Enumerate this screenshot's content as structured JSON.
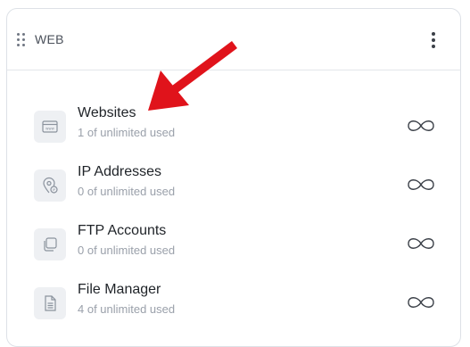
{
  "card": {
    "title": "WEB",
    "drag_icon": "drag-handle-icon",
    "menu_icon": "more-vertical-icon"
  },
  "items": [
    {
      "name": "Websites",
      "usage": "1 of unlimited used",
      "icon": "website-icon",
      "limit_icon": "infinity-icon"
    },
    {
      "name": "IP Addresses",
      "usage": "0 of unlimited used",
      "icon": "ip-address-icon",
      "limit_icon": "infinity-icon"
    },
    {
      "name": "FTP Accounts",
      "usage": "0 of unlimited used",
      "icon": "ftp-accounts-icon",
      "limit_icon": "infinity-icon"
    },
    {
      "name": "File Manager",
      "usage": "4 of unlimited used",
      "icon": "file-manager-icon",
      "limit_icon": "infinity-icon"
    }
  ],
  "annotation": {
    "arrow_color": "#e0131b",
    "arrow_icon": "pointer-arrow-icon"
  },
  "colors": {
    "icon_bg": "#eef0f3",
    "icon_stroke": "#8a929d",
    "title": "#1f2328",
    "subtitle": "#9aa0aa"
  }
}
